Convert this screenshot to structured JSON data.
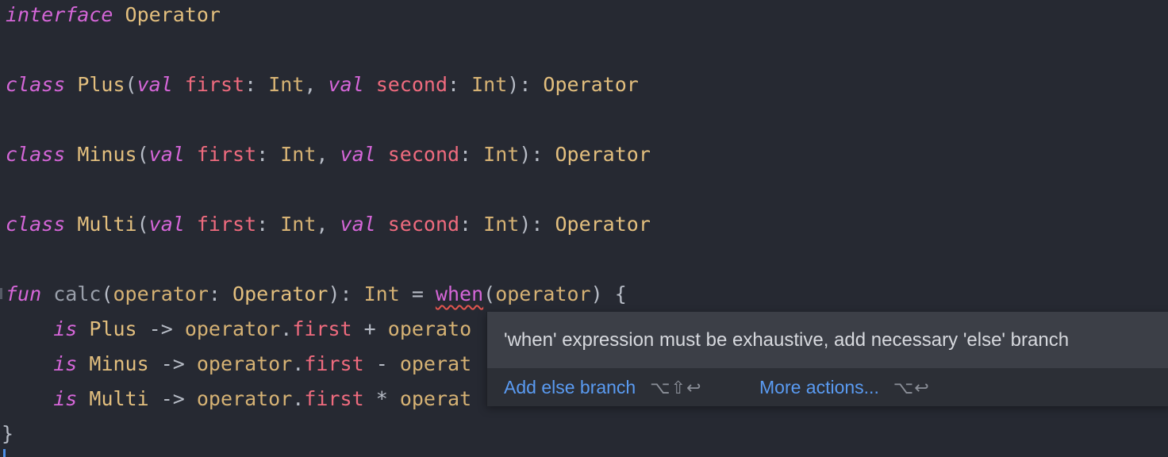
{
  "code": {
    "line1": {
      "kw": "interface",
      "name": "Operator"
    },
    "line2": {
      "kw": "class",
      "name": "Plus",
      "val1": "val",
      "p1": "first",
      "t1": "Int",
      "val2": "val",
      "p2": "second",
      "t2": "Int",
      "super": "Operator"
    },
    "line3": {
      "kw": "class",
      "name": "Minus",
      "val1": "val",
      "p1": "first",
      "t1": "Int",
      "val2": "val",
      "p2": "second",
      "t2": "Int",
      "super": "Operator"
    },
    "line4": {
      "kw": "class",
      "name": "Multi",
      "val1": "val",
      "p1": "first",
      "t1": "Int",
      "val2": "val",
      "p2": "second",
      "t2": "Int",
      "super": "Operator"
    },
    "line5": {
      "kw": "fun",
      "name": "calc",
      "param": "operator",
      "ptype": "Operator",
      "ret": "Int",
      "when": "when",
      "arg": "operator"
    },
    "branch1": {
      "is": "is",
      "type": "Plus",
      "recv": "operator",
      "prop": "first",
      "op": "+",
      "tail": "operato"
    },
    "branch2": {
      "is": "is",
      "type": "Minus",
      "recv": "operator",
      "prop": "first",
      "op": "-",
      "tail": "operat"
    },
    "branch3": {
      "is": "is",
      "type": "Multi",
      "recv": "operator",
      "prop": "first",
      "op": "*",
      "tail": "operat"
    },
    "closing": "}"
  },
  "popup": {
    "message": "'when' expression must be exhaustive, add necessary 'else' branch",
    "actions": [
      {
        "label": "Add else branch",
        "shortcut": "⌥⇧↩"
      },
      {
        "label": "More actions...",
        "shortcut": "⌥↩"
      }
    ]
  },
  "colors": {
    "background": "#262932",
    "keyword": "#d566d8",
    "class_name": "#e3bf7e",
    "property": "#ef6b7e",
    "link": "#5a9bf2",
    "error_underline": "#e2554f"
  }
}
